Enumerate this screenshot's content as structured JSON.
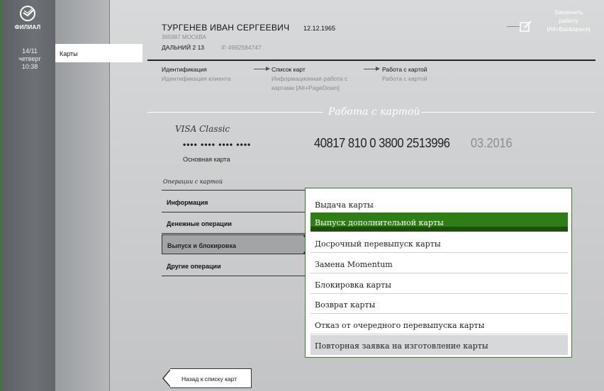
{
  "sidebar": {
    "brand": "ФИЛИАЛ",
    "date": "14/11",
    "weekday": "четверг",
    "time": "10:38",
    "active_item": "Карты"
  },
  "client": {
    "name": "ТУРГЕНЕВ ИВАН СЕРГЕЕВИЧ",
    "dob": "12.12.1965",
    "code_city": "365987 МОСКВА",
    "address": "ДАЛЬНИЙ 2 13",
    "phone": "4992584747"
  },
  "header": {
    "finish_line1": "Закончить",
    "finish_line2": "работу",
    "finish_line3": "[Alt+Backspace]"
  },
  "steps": [
    {
      "title": "Идентификация",
      "subtitle": "Идентификация клиента",
      "subtitle2": ""
    },
    {
      "title": "Список карт",
      "subtitle": "Информационная работа с",
      "subtitle2": "картами [Alt+PageDown]"
    },
    {
      "title": "Работа с картой",
      "subtitle": "Работа с картой",
      "subtitle2": ""
    }
  ],
  "section_title": "Работа с картой",
  "card": {
    "type": "VISA Classic",
    "masked": "•••• •••• •••• ••••",
    "label": "Основная карта",
    "account": "40817 810 0 3800 2513996",
    "expiry": "03.2016"
  },
  "operations": {
    "title": "Операции с картой",
    "items": [
      "Информация",
      "Денежные операции",
      "Выпуск и блокировка",
      "Другие операции"
    ]
  },
  "dropdown": {
    "items": [
      "Выдача карты",
      "Выпуск дополнительной карты",
      "Досрочный перевыпуск карты",
      "Замена Momentum",
      "Блокировка карты",
      "Возврат карты",
      "Отказ от очередного перевыпуска карты",
      "Повторная заявка на изготовление карты"
    ]
  },
  "back_button": "Назад к списку карт",
  "colors": {
    "accent_green": "#2f7d16",
    "rail": "#6d7175"
  }
}
